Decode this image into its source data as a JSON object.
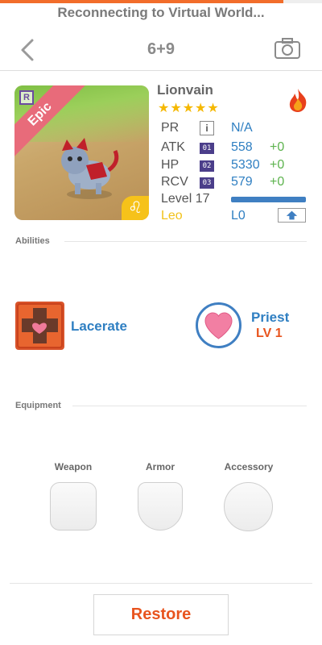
{
  "status": {
    "text": "Reconnecting to Virtual World...",
    "progress_fraction": 0.88,
    "accent_color": "#f26d2b"
  },
  "nav": {
    "title": "6+9",
    "back_icon": "chevron-left-icon",
    "camera_icon": "camera-icon"
  },
  "pet": {
    "name": "Lionvain",
    "rarity_tag": "R",
    "rarity": "Epic",
    "stars": "★★★★★",
    "star_count": 5,
    "element_icon": "fire-icon",
    "zodiac_glyph": "♌",
    "stats": {
      "pr": {
        "label": "PR",
        "info": "i",
        "value": "N/A"
      },
      "atk": {
        "label": "ATK",
        "badge": "01",
        "value": "558",
        "bonus": "+0"
      },
      "hp": {
        "label": "HP",
        "badge": "02",
        "value": "5330",
        "bonus": "+0"
      },
      "rcv": {
        "label": "RCV",
        "badge": "03",
        "value": "579",
        "bonus": "+0"
      }
    },
    "level_label": "Level 17",
    "level_progress_fraction": 1.0,
    "sign": "Leo",
    "sign_level": "L0"
  },
  "abilities": {
    "section_label": "Abilities",
    "skill_name": "Lacerate",
    "class_name": "Priest",
    "class_level": "LV 1"
  },
  "equipment": {
    "section_label": "Equipment",
    "slots": [
      "Weapon",
      "Armor",
      "Accessory"
    ]
  },
  "footer": {
    "restore_label": "Restore"
  }
}
